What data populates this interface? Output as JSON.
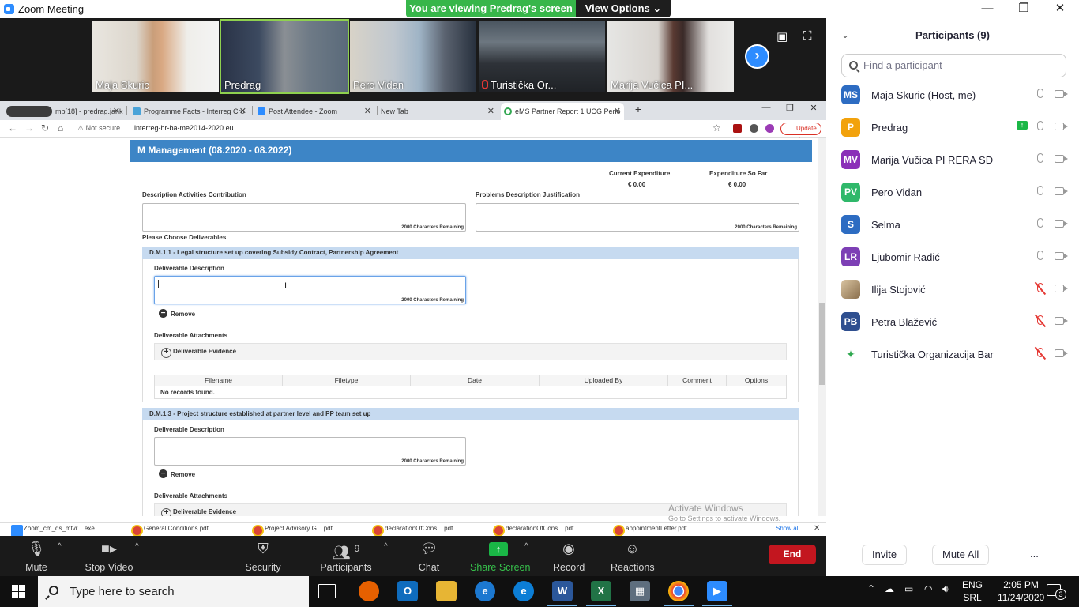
{
  "zoom": {
    "window_title": "Zoom Meeting",
    "viewing_banner": "You are viewing Predrag's screen",
    "view_options": "View Options",
    "video_tiles": [
      {
        "name": "Maja Skuric"
      },
      {
        "name": "Predrag"
      },
      {
        "name": "Pero Vidan"
      },
      {
        "name": "Turistička Or..."
      },
      {
        "name": "Marija Vučica PI..."
      }
    ],
    "toolbar": {
      "mute": "Mute",
      "stop_video": "Stop Video",
      "security": "Security",
      "participants": "Participants",
      "participants_count": "9",
      "chat": "Chat",
      "share_screen": "Share Screen",
      "record": "Record",
      "reactions": "Reactions",
      "end": "End"
    },
    "colors": {
      "accent": "#2d8cff",
      "green": "#37b64a",
      "end": "#c3161f"
    }
  },
  "browser": {
    "tabs": [
      {
        "label": "mb[18] - predrag.jank@gm"
      },
      {
        "label": "Programme Facts - Interreg Cro"
      },
      {
        "label": "Post Attendee - Zoom"
      },
      {
        "label": "New Tab"
      },
      {
        "label": "eMS Partner Report 1 UCG Perio"
      }
    ],
    "not_secure": "Not secure",
    "url": "interreg-hr-ba-me2014-2020.eu",
    "update": "Update",
    "page": {
      "section_title": "M Management (08.2020 - 08.2022)",
      "current_expenditure_label": "Current Expenditure",
      "current_expenditure_value": "€ 0.00",
      "expenditure_so_far_label": "Expenditure So Far",
      "expenditure_so_far_value": "€ 0.00",
      "description_label": "Description Activities Contribution",
      "problems_label": "Problems Description Justification",
      "chars_remaining": "2000 Characters Remaining",
      "choose_deliverables": "Please Choose Deliverables",
      "deliverable1_title": "D.M.1.1 - Legal structure set up covering Subsidy Contract, Partnership Agreement",
      "deliverable2_title": "D.M.1.3 - Project structure established at partner level and PP team set up",
      "deliverable_description": "Deliverable Description",
      "remove": "Remove",
      "deliverable_attachments": "Deliverable Attachments",
      "deliverable_evidence": "Deliverable Evidence",
      "table_columns": [
        "Filename",
        "Filetype",
        "Date",
        "Uploaded By",
        "Comment",
        "Options"
      ],
      "no_records": "No records found.",
      "activate_windows": "Activate Windows",
      "activate_windows_sub": "Go to Settings to activate Windows."
    },
    "downloads": [
      {
        "label": "Zoom_cm_ds_mtvr....exe"
      },
      {
        "label": "General Conditions.pdf"
      },
      {
        "label": "Project Advisory G....pdf"
      },
      {
        "label": "declarationOfCons....pdf"
      },
      {
        "label": "declarationOfCons....pdf"
      },
      {
        "label": "appointmentLetter.pdf"
      }
    ],
    "show_all": "Show all"
  },
  "panel": {
    "title": "Participants (9)",
    "search_placeholder": "Find a participant",
    "participants": [
      {
        "initials": "MS",
        "name": "Maja Skuric (Host, me)",
        "color": "#2d6cc2",
        "muted": false
      },
      {
        "initials": "P",
        "name": "Predrag",
        "color": "#f2a20c",
        "muted": false,
        "sharing": true
      },
      {
        "initials": "MV",
        "name": "Marija Vučica PI RERA SD",
        "color": "#8b2fb8",
        "muted": false
      },
      {
        "initials": "PV",
        "name": "Pero Vidan",
        "color": "#2fb86a",
        "muted": false
      },
      {
        "initials": "S",
        "name": "Selma",
        "color": "#2d6cc2",
        "muted": false
      },
      {
        "initials": "LR",
        "name": "Ljubomir Radić",
        "color": "#7d3fb5",
        "muted": false
      },
      {
        "initials": "",
        "name": "Ilija Stojović",
        "color": "#c9b28f",
        "muted": true
      },
      {
        "initials": "PB",
        "name": "Petra Blažević",
        "color": "#2f4f8f",
        "muted": true
      },
      {
        "initials": "",
        "name": "Turistička Organizacija Bar",
        "color": "#ffffff",
        "muted": true
      }
    ],
    "invite": "Invite",
    "mute_all": "Mute All",
    "more": "..."
  },
  "taskbar": {
    "search_placeholder": "Type here to search",
    "lang_top": "ENG",
    "lang_bottom": "SRL",
    "time": "2:05 PM",
    "date": "11/24/2020",
    "notifications": "3"
  }
}
